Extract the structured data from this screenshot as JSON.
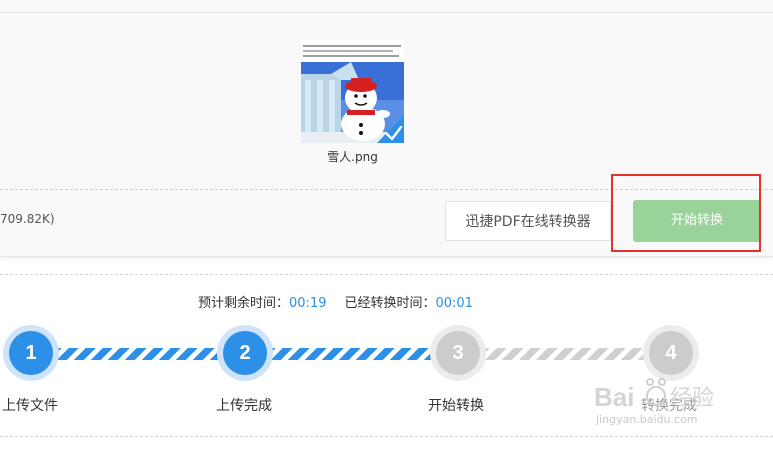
{
  "upload": {
    "file_name": "雪人.png",
    "file_size": "709.82K)",
    "tool_name": "迅捷PDF在线转换器",
    "start_button": "开始转换"
  },
  "progress": {
    "remaining_label": "预计剩余时间：",
    "remaining_value": "00:19",
    "elapsed_label": "已经转换时间：",
    "elapsed_value": "00:01",
    "steps": [
      {
        "number": "1",
        "label": "上传文件",
        "state": "done"
      },
      {
        "number": "2",
        "label": "上传完成",
        "state": "done"
      },
      {
        "number": "3",
        "label": "开始转换",
        "state": "pending"
      },
      {
        "number": "4",
        "label": "转换完成",
        "state": "pending"
      }
    ]
  },
  "watermark": {
    "text": "jingyan.baidu.com"
  },
  "colors": {
    "accent": "#2c8fe8",
    "button_green": "#9ad39a",
    "highlight_red": "#e5322d",
    "pending_gray": "#cccccc"
  }
}
